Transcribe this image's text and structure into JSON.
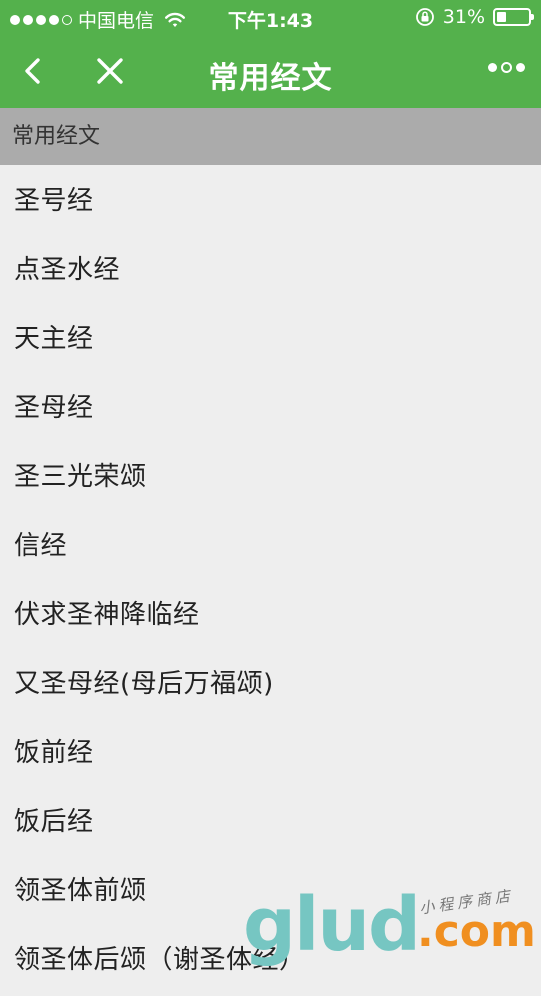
{
  "status_bar": {
    "carrier": "中国电信",
    "time": "下午1:43",
    "battery_percent": "31%",
    "battery_level": 0.31
  },
  "navbar": {
    "title": "常用经文"
  },
  "section": {
    "header": "常用经文"
  },
  "items": [
    "圣号经",
    "点圣水经",
    "天主经",
    "圣母经",
    "圣三光荣颂",
    "信经",
    "伏求圣神降临经",
    "又圣母经(母后万福颂)",
    "饭前经",
    "饭后经",
    "领圣体前颂",
    "领圣体后颂（谢圣体经）"
  ],
  "watermark": {
    "main": "glud",
    "com": ".com",
    "sub": "小程序商店"
  },
  "colors": {
    "nav_green": "#54b14c",
    "section_gray": "#ababab",
    "background": "#eeeeee"
  }
}
